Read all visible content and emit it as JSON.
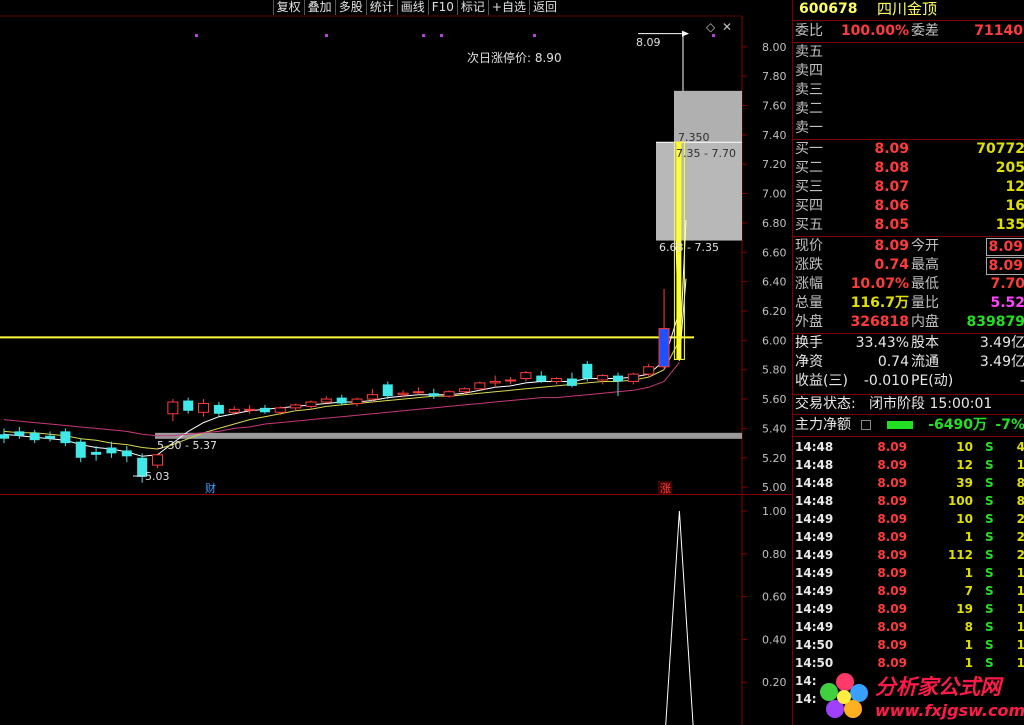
{
  "toolbar": [
    "复权",
    "叠加",
    "多股",
    "统计",
    "画线",
    "F10",
    "标记",
    "+自选",
    "返回"
  ],
  "stock": {
    "code": "600678",
    "name": "四川金顶"
  },
  "weibi": {
    "label": "委比",
    "value": "100.00%",
    "label2": "委差",
    "value2": "71140"
  },
  "sells": [
    {
      "label": "卖五"
    },
    {
      "label": "卖四"
    },
    {
      "label": "卖三"
    },
    {
      "label": "卖二"
    },
    {
      "label": "卖一"
    }
  ],
  "buys": [
    {
      "label": "买一",
      "price": "8.09",
      "vol": "70772"
    },
    {
      "label": "买二",
      "price": "8.08",
      "vol": "205"
    },
    {
      "label": "买三",
      "price": "8.07",
      "vol": "12"
    },
    {
      "label": "买四",
      "price": "8.06",
      "vol": "16"
    },
    {
      "label": "买五",
      "price": "8.05",
      "vol": "135"
    }
  ],
  "quote": {
    "xianjia": {
      "label": "现价",
      "value": "8.09",
      "label2": "今开",
      "value2": "8.09"
    },
    "zhangdie": {
      "label": "涨跌",
      "value": "0.74",
      "label2": "最高",
      "value2": "8.09"
    },
    "zhangfu": {
      "label": "涨幅",
      "value": "10.07%",
      "label2": "最低",
      "value2": "7.70"
    },
    "zongliang": {
      "label": "总量",
      "value": "116.7万",
      "label2": "量比",
      "value2": "5.52"
    },
    "waipan": {
      "label": "外盘",
      "value": "326818",
      "label2": "内盘",
      "value2": "839879"
    }
  },
  "fund": {
    "huanshou": {
      "label": "换手",
      "value": "33.43%",
      "label2": "股本",
      "value2": "3.49亿"
    },
    "jingzi": {
      "label": "净资",
      "value": "0.74",
      "label2": "流通",
      "value2": "3.49亿"
    },
    "shouyi": {
      "label": "收益(三)",
      "value": "-0.010",
      "label2": "PE(动)",
      "value2": "-"
    }
  },
  "status": {
    "label": "交易状态:",
    "value": "闭市阶段 15:00:01"
  },
  "mainforce": {
    "label": "主力净额",
    "value": "-6490万",
    "pct": "-7%"
  },
  "ticks": [
    {
      "time": "14:48",
      "price": "8.09",
      "vol": "10",
      "dir": "S",
      "n": "4"
    },
    {
      "time": "14:48",
      "price": "8.09",
      "vol": "12",
      "dir": "S",
      "n": "1"
    },
    {
      "time": "14:48",
      "price": "8.09",
      "vol": "39",
      "dir": "S",
      "n": "8"
    },
    {
      "time": "14:48",
      "price": "8.09",
      "vol": "100",
      "dir": "S",
      "n": "8"
    },
    {
      "time": "14:49",
      "price": "8.09",
      "vol": "10",
      "dir": "S",
      "n": "2"
    },
    {
      "time": "14:49",
      "price": "8.09",
      "vol": "1",
      "dir": "S",
      "n": "2"
    },
    {
      "time": "14:49",
      "price": "8.09",
      "vol": "112",
      "dir": "S",
      "n": "2"
    },
    {
      "time": "14:49",
      "price": "8.09",
      "vol": "1",
      "dir": "S",
      "n": "1"
    },
    {
      "time": "14:49",
      "price": "8.09",
      "vol": "7",
      "dir": "S",
      "n": "1"
    },
    {
      "time": "14:49",
      "price": "8.09",
      "vol": "19",
      "dir": "S",
      "n": "1"
    },
    {
      "time": "14:49",
      "price": "8.09",
      "vol": "8",
      "dir": "S",
      "n": "1"
    },
    {
      "time": "14:50",
      "price": "8.09",
      "vol": "1",
      "dir": "S",
      "n": "1"
    },
    {
      "time": "14:50",
      "price": "8.09",
      "vol": "1",
      "dir": "S",
      "n": "1"
    },
    {
      "time": "14:",
      "price": "",
      "vol": "",
      "dir": "",
      "n": ""
    },
    {
      "time": "14:",
      "price": "",
      "vol": "",
      "dir": "",
      "n": ""
    }
  ],
  "chart_labels": {
    "limit_up": "次日涨停价: 8.90",
    "last_price": "8.09",
    "box_top": "7.350",
    "box_top_range": "7.35 - 7.70",
    "box_mid_range": "6.68 - 7.35",
    "box_low_range": "5.30 - 5.37",
    "low": "5.03",
    "cai": "财",
    "zhang": "涨"
  },
  "watermark": {
    "text": "分析家公式网",
    "url": "www.fxjgsw.com"
  },
  "chart_data": [
    {
      "type": "candlestick",
      "yaxis_ticks": [
        "8.00",
        "7.80",
        "7.60",
        "7.40",
        "7.20",
        "7.00",
        "6.80",
        "6.60",
        "6.40",
        "6.20",
        "6.00",
        "5.80",
        "5.60",
        "5.40",
        "5.20",
        "5.00"
      ],
      "ylim": [
        4.96,
        8.21
      ],
      "highlight_level": 6.02,
      "zones": [
        {
          "low": 5.33,
          "high": 5.37
        },
        {
          "low": 6.68,
          "high": 7.35
        },
        {
          "low": 7.35,
          "high": 7.7
        }
      ],
      "candles": [
        {
          "o": 5.36,
          "h": 5.4,
          "c": 5.33,
          "l": 5.3
        },
        {
          "o": 5.38,
          "h": 5.41,
          "c": 5.35,
          "l": 5.33
        },
        {
          "o": 5.37,
          "h": 5.39,
          "c": 5.32,
          "l": 5.3
        },
        {
          "o": 5.35,
          "h": 5.38,
          "c": 5.33,
          "l": 5.31
        },
        {
          "o": 5.38,
          "h": 5.4,
          "c": 5.3,
          "l": 5.28
        },
        {
          "o": 5.31,
          "h": 5.33,
          "c": 5.2,
          "l": 5.17
        },
        {
          "o": 5.24,
          "h": 5.28,
          "c": 5.22,
          "l": 5.18
        },
        {
          "o": 5.27,
          "h": 5.31,
          "c": 5.23,
          "l": 5.2
        },
        {
          "o": 5.25,
          "h": 5.28,
          "c": 5.21,
          "l": 5.17
        },
        {
          "o": 5.2,
          "h": 5.23,
          "c": 5.07,
          "l": 5.03
        },
        {
          "o": 5.15,
          "h": 5.21,
          "c": 5.22,
          "l": 5.13
        },
        {
          "o": 5.5,
          "h": 5.6,
          "c": 5.58,
          "l": 5.45
        },
        {
          "o": 5.59,
          "h": 5.61,
          "c": 5.52,
          "l": 5.5
        },
        {
          "o": 5.51,
          "h": 5.6,
          "c": 5.57,
          "l": 5.48
        },
        {
          "o": 5.56,
          "h": 5.58,
          "c": 5.5,
          "l": 5.48
        },
        {
          "o": 5.51,
          "h": 5.55,
          "c": 5.53,
          "l": 5.49
        },
        {
          "o": 5.53,
          "h": 5.56,
          "c": 5.53,
          "l": 5.5
        },
        {
          "o": 5.54,
          "h": 5.56,
          "c": 5.51,
          "l": 5.5
        },
        {
          "o": 5.51,
          "h": 5.55,
          "c": 5.54,
          "l": 5.49
        },
        {
          "o": 5.54,
          "h": 5.57,
          "c": 5.56,
          "l": 5.52
        },
        {
          "o": 5.55,
          "h": 5.59,
          "c": 5.58,
          "l": 5.53
        },
        {
          "o": 5.58,
          "h": 5.62,
          "c": 5.6,
          "l": 5.57
        },
        {
          "o": 5.61,
          "h": 5.63,
          "c": 5.57,
          "l": 5.56
        },
        {
          "o": 5.57,
          "h": 5.61,
          "c": 5.6,
          "l": 5.55
        },
        {
          "o": 5.6,
          "h": 5.67,
          "c": 5.63,
          "l": 5.58
        },
        {
          "o": 5.7,
          "h": 5.72,
          "c": 5.62,
          "l": 5.6
        },
        {
          "o": 5.63,
          "h": 5.66,
          "c": 5.64,
          "l": 5.61
        },
        {
          "o": 5.65,
          "h": 5.68,
          "c": 5.65,
          "l": 5.63
        },
        {
          "o": 5.64,
          "h": 5.67,
          "c": 5.62,
          "l": 5.6
        },
        {
          "o": 5.62,
          "h": 5.66,
          "c": 5.65,
          "l": 5.61
        },
        {
          "o": 5.65,
          "h": 5.68,
          "c": 5.67,
          "l": 5.63
        },
        {
          "o": 5.67,
          "h": 5.72,
          "c": 5.71,
          "l": 5.66
        },
        {
          "o": 5.71,
          "h": 5.76,
          "c": 5.72,
          "l": 5.68
        },
        {
          "o": 5.73,
          "h": 5.75,
          "c": 5.73,
          "l": 5.7
        },
        {
          "o": 5.74,
          "h": 5.79,
          "c": 5.78,
          "l": 5.72
        },
        {
          "o": 5.76,
          "h": 5.79,
          "c": 5.72,
          "l": 5.71
        },
        {
          "o": 5.72,
          "h": 5.75,
          "c": 5.74,
          "l": 5.7
        },
        {
          "o": 5.74,
          "h": 5.78,
          "c": 5.69,
          "l": 5.68
        },
        {
          "o": 5.84,
          "h": 5.86,
          "c": 5.74,
          "l": 5.72
        },
        {
          "o": 5.73,
          "h": 5.77,
          "c": 5.76,
          "l": 5.7
        },
        {
          "o": 5.76,
          "h": 5.78,
          "c": 5.72,
          "l": 5.62
        },
        {
          "o": 5.72,
          "h": 5.78,
          "c": 5.77,
          "l": 5.7
        },
        {
          "o": 5.77,
          "h": 5.84,
          "c": 5.82,
          "l": 5.75
        },
        {
          "o": 5.82,
          "h": 6.35,
          "c": 6.08,
          "l": 5.8
        },
        {
          "o": 7.35,
          "h": 7.35,
          "c": 5.87,
          "l": 5.86
        }
      ],
      "ma_lines": [
        {
          "color": "#ffffff",
          "values": [
            5.36,
            5.35,
            5.34,
            5.33,
            5.32,
            5.29,
            5.27,
            5.26,
            5.24,
            5.21,
            5.22,
            5.3,
            5.38,
            5.44,
            5.48,
            5.5,
            5.52,
            5.53,
            5.54,
            5.55,
            5.56,
            5.57,
            5.58,
            5.58,
            5.59,
            5.61,
            5.62,
            5.63,
            5.63,
            5.63,
            5.64,
            5.66,
            5.68,
            5.69,
            5.71,
            5.72,
            5.72,
            5.72,
            5.74,
            5.74,
            5.74,
            5.75,
            5.77,
            5.86,
            6.2
          ]
        },
        {
          "color": "#d8d850",
          "values": [
            5.38,
            5.37,
            5.37,
            5.36,
            5.35,
            5.33,
            5.32,
            5.3,
            5.29,
            5.27,
            5.26,
            5.29,
            5.33,
            5.37,
            5.4,
            5.43,
            5.46,
            5.48,
            5.5,
            5.52,
            5.53,
            5.55,
            5.56,
            5.57,
            5.58,
            5.59,
            5.6,
            5.61,
            5.62,
            5.62,
            5.63,
            5.64,
            5.65,
            5.66,
            5.67,
            5.68,
            5.69,
            5.7,
            5.71,
            5.72,
            5.72,
            5.73,
            5.75,
            5.8,
            6.0
          ]
        },
        {
          "color": "#c8387a",
          "values": [
            5.46,
            5.45,
            5.44,
            5.43,
            5.42,
            5.41,
            5.4,
            5.39,
            5.38,
            5.36,
            5.35,
            5.35,
            5.36,
            5.37,
            5.38,
            5.4,
            5.41,
            5.43,
            5.44,
            5.45,
            5.46,
            5.47,
            5.48,
            5.49,
            5.5,
            5.51,
            5.52,
            5.53,
            5.54,
            5.55,
            5.56,
            5.57,
            5.58,
            5.59,
            5.6,
            5.61,
            5.61,
            5.62,
            5.63,
            5.64,
            5.65,
            5.66,
            5.68,
            5.72,
            5.85
          ]
        }
      ]
    },
    {
      "type": "line",
      "yaxis_ticks": [
        "1.00",
        "0.80",
        "0.60",
        "0.40",
        "0.20"
      ],
      "ylim": [
        0,
        1.07
      ],
      "values": [
        0,
        0,
        0,
        0,
        0,
        0,
        0,
        0,
        0,
        0,
        0,
        0,
        0,
        0,
        0,
        0,
        0,
        0,
        0,
        0,
        0,
        0,
        0,
        0,
        0,
        0,
        0,
        0,
        0,
        0,
        0,
        0,
        0,
        0,
        0,
        0,
        0,
        0,
        0,
        0,
        0,
        0,
        0,
        0,
        1.0
      ]
    }
  ]
}
